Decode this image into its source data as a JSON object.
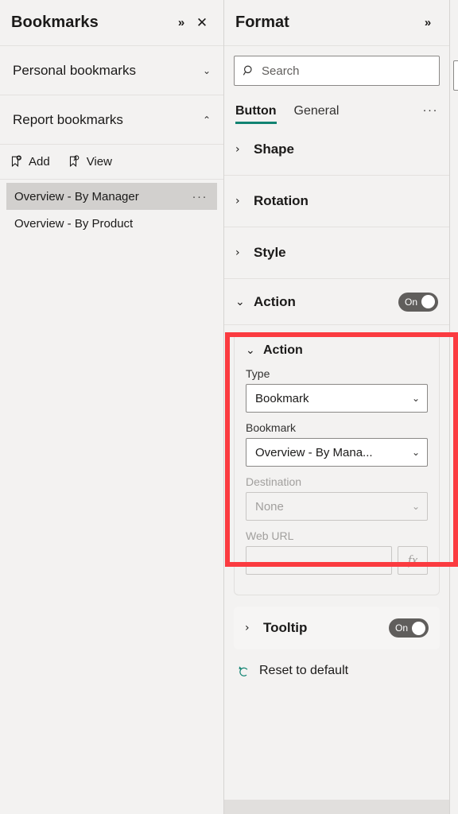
{
  "bookmarks_pane": {
    "title": "Bookmarks",
    "expand_icon": "double-chevron-right-icon",
    "close_icon": "close-icon",
    "sections": [
      {
        "label": "Personal bookmarks",
        "state": "collapsed",
        "caret": "⌄"
      },
      {
        "label": "Report bookmarks",
        "state": "expanded",
        "caret": "⌃"
      }
    ],
    "toolbar": [
      {
        "label": "Add",
        "icon": "bookmark-add-icon"
      },
      {
        "label": "View",
        "icon": "bookmark-view-icon"
      }
    ],
    "list": [
      {
        "name": "Overview - By Manager",
        "selected": true,
        "more": "···"
      },
      {
        "name": "Overview - By Product",
        "selected": false,
        "more": ""
      }
    ]
  },
  "format_pane": {
    "title": "Format",
    "expand_icon": "double-chevron-right-icon",
    "search": {
      "placeholder": "Search",
      "value": "",
      "icon": "search-icon"
    },
    "tabs": [
      {
        "label": "Button",
        "active": true
      },
      {
        "label": "General",
        "active": false
      }
    ],
    "tabs_more": "···",
    "accordions": [
      {
        "label": "Shape",
        "caret": "›"
      },
      {
        "label": "Rotation",
        "caret": "›"
      },
      {
        "label": "Style",
        "caret": "›"
      }
    ],
    "action_section": {
      "label": "Action",
      "caret": "⌄",
      "toggle": {
        "label": "On",
        "state": "on"
      },
      "card": {
        "label": "Action",
        "caret": "⌄",
        "fields": [
          {
            "label": "Type",
            "value": "Bookmark",
            "disabled": false,
            "caret": "⌄"
          },
          {
            "label": "Bookmark",
            "value": "Overview - By Mana...",
            "disabled": false,
            "caret": "⌄"
          },
          {
            "label": "Destination",
            "value": "None",
            "disabled": true,
            "caret": "⌄"
          }
        ],
        "web_url": {
          "label": "Web URL",
          "value": "",
          "disabled": true,
          "fx_label": "fx"
        }
      }
    },
    "tooltip_section": {
      "label": "Tooltip",
      "caret": "›",
      "toggle": {
        "label": "On",
        "state": "on"
      }
    },
    "reset": {
      "label": "Reset to default",
      "icon": "undo-arrow-icon"
    }
  },
  "highlight": {
    "color": "#fb3b40",
    "target": "action-section"
  },
  "colors": {
    "accent_teal": "#118372",
    "panel_bg": "#f3f2f1",
    "selected_row": "#d2d0ce",
    "toggle_on": "#605e5c",
    "highlight_red": "#fb3b40"
  }
}
